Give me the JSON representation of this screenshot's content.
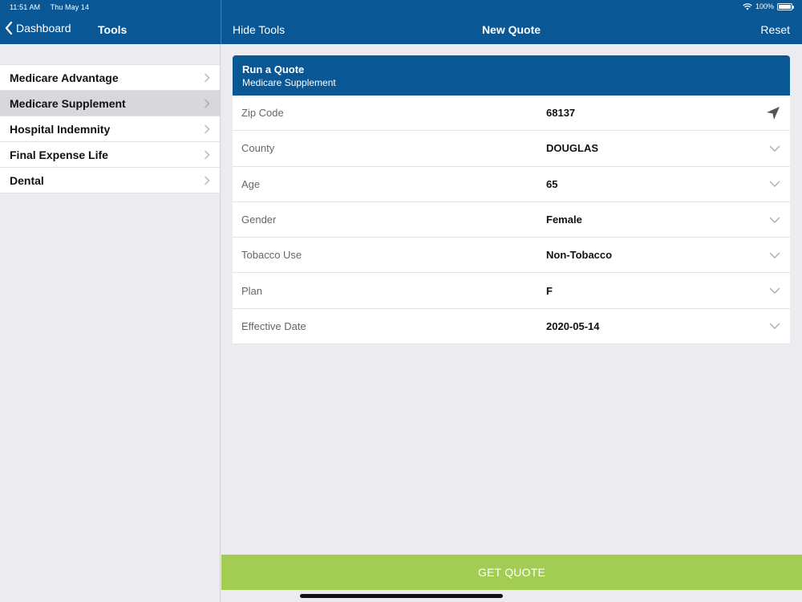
{
  "status": {
    "time": "11:51 AM",
    "date": "Thu May 14",
    "battery": "100%"
  },
  "nav": {
    "back_label": "Dashboard",
    "sidebar_title": "Tools",
    "hide_tools": "Hide Tools",
    "main_title": "New Quote",
    "reset": "Reset"
  },
  "sidebar": {
    "items": [
      {
        "label": "Medicare Advantage"
      },
      {
        "label": "Medicare Supplement"
      },
      {
        "label": "Hospital Indemnity"
      },
      {
        "label": "Final Expense Life"
      },
      {
        "label": "Dental"
      }
    ]
  },
  "card": {
    "title": "Run a Quote",
    "subtitle": "Medicare Supplement"
  },
  "form": {
    "rows": [
      {
        "label": "Zip Code",
        "value": "68137",
        "icon": "location-arrow-icon"
      },
      {
        "label": "County",
        "value": "DOUGLAS",
        "icon": "chevron-down-icon"
      },
      {
        "label": "Age",
        "value": "65",
        "icon": "chevron-down-icon"
      },
      {
        "label": "Gender",
        "value": "Female",
        "icon": "chevron-down-icon"
      },
      {
        "label": "Tobacco Use",
        "value": "Non-Tobacco",
        "icon": "chevron-down-icon"
      },
      {
        "label": "Plan",
        "value": "F",
        "icon": "chevron-down-icon"
      },
      {
        "label": "Effective Date",
        "value": "2020-05-14",
        "icon": "chevron-down-icon"
      }
    ]
  },
  "actions": {
    "get_quote": "GET QUOTE"
  },
  "colors": {
    "brand_blue": "#0a5796",
    "action_green": "#a2cc52",
    "selected_gray": "#d7d7dc"
  }
}
